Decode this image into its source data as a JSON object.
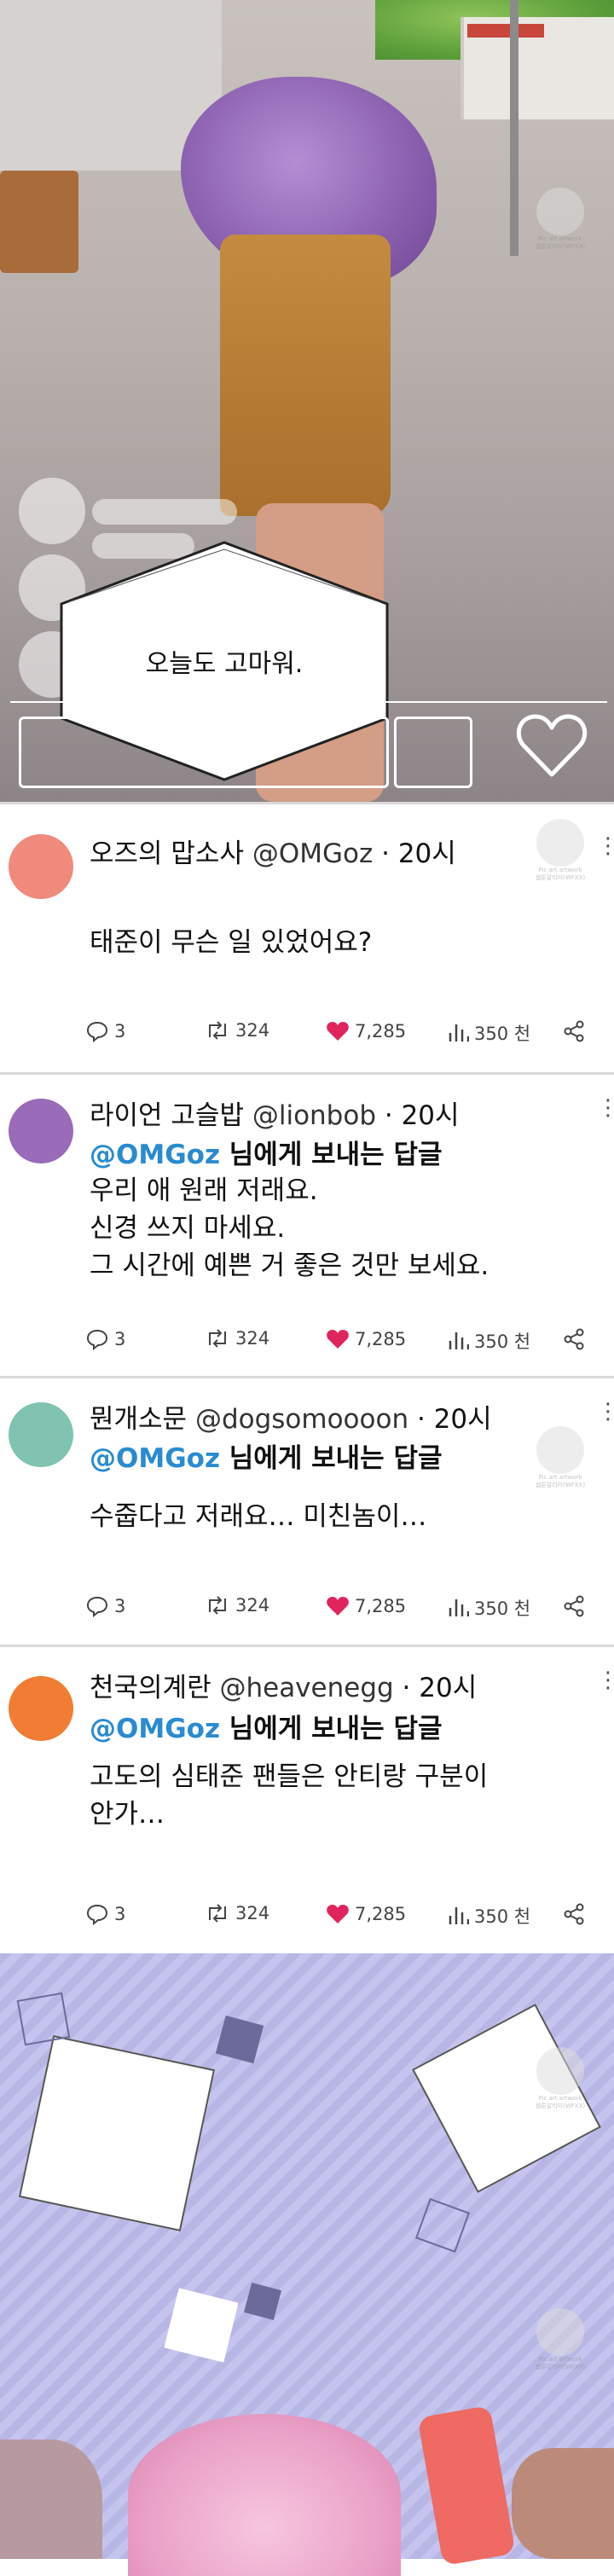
{
  "panel_top": {
    "speech": "오늘도 고마워."
  },
  "colors": {
    "mention": "#2a8bd0",
    "like_heart": "#e0245e",
    "icon_gray": "#444444"
  },
  "tweets": [
    {
      "avatar_color": "#f08a7c",
      "name": "오즈의 맙소사",
      "handle": "@OMGoz",
      "time": "· 20시",
      "reply_mention": "",
      "reply_suffix": "",
      "body": [
        "태준이 무슨 일 있었어요?"
      ],
      "stats": {
        "replies": "3",
        "retweets": "324",
        "likes": "7,285",
        "views": "350 천"
      }
    },
    {
      "avatar_color": "#9a6bb8",
      "name": "라이언 고슬밥",
      "handle": "@lionbob",
      "time": "· 20시",
      "reply_mention": "@OMGoz",
      "reply_suffix": " 님에게 보내는 답글",
      "body": [
        "우리 애 원래 저래요.",
        "신경 쓰지 마세요.",
        "그 시간에 예쁜 거 좋은 것만 보세요."
      ],
      "stats": {
        "replies": "3",
        "retweets": "324",
        "likes": "7,285",
        "views": "350 천"
      }
    },
    {
      "avatar_color": "#7fc3b0",
      "name": "뭔개소문",
      "handle": "@dogsomoooon",
      "time": "· 20시",
      "reply_mention": "@OMGoz",
      "reply_suffix": " 님에게 보내는 답글",
      "body": [
        "수줍다고 저래요… 미친놈이…"
      ],
      "stats": {
        "replies": "3",
        "retweets": "324",
        "likes": "7,285",
        "views": "350 천"
      }
    },
    {
      "avatar_color": "#f07d33",
      "name": "천국의계란",
      "handle": "@heavenegg",
      "time": "· 20시",
      "reply_mention": "@OMGoz",
      "reply_suffix": " 님에게 보내는 답글",
      "body": [
        "고도의 심태준 팬들은 안티랑 구분이",
        "안가…"
      ],
      "stats": {
        "replies": "3",
        "retweets": "324",
        "likes": "7,285",
        "views": "350 천"
      }
    }
  ],
  "watermark": {
    "line1": "Pic art artwork",
    "line2": "웹툰알리미(WFXX)"
  }
}
